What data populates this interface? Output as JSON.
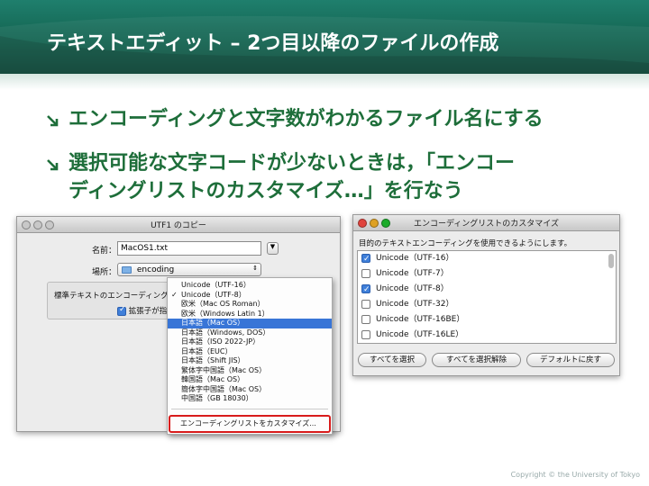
{
  "slide": {
    "title": "テキストエディット – 2つ目以降のファイルの作成",
    "bullets": [
      "エンコーディングと文字数がわかるファイル名にする",
      "選択可能な文字コードが少ないときは，「エンコー",
      "ディングリストのカスタマイズ…」を行なう"
    ],
    "copyright": "Copyright © the University of Tokyo"
  },
  "save_dialog": {
    "title": "UTF1 のコピー",
    "name_label": "名前：",
    "name_value": "MacOS1.txt",
    "location_label": "場所：",
    "location_value": "encoding",
    "encoding_label": "標準テキストのエンコーディング",
    "extension_label": "拡張子が指定",
    "menu_items": [
      {
        "label": "Unicode（UTF-16）",
        "checked": false,
        "selected": false
      },
      {
        "label": "Unicode（UTF-8）",
        "checked": true,
        "selected": false
      },
      {
        "label": "欧米（Mac OS Roman）",
        "checked": false,
        "selected": false
      },
      {
        "label": "欧米（Windows Latin 1）",
        "checked": false,
        "selected": false
      },
      {
        "label": "日本語（Mac OS）",
        "checked": false,
        "selected": true
      },
      {
        "label": "日本語（Windows, DOS）",
        "checked": false,
        "selected": false
      },
      {
        "label": "日本語（ISO 2022-JP）",
        "checked": false,
        "selected": false
      },
      {
        "label": "日本語（EUC）",
        "checked": false,
        "selected": false
      },
      {
        "label": "日本語（Shift JIS）",
        "checked": false,
        "selected": false
      },
      {
        "label": "繁体字中国語（Mac OS）",
        "checked": false,
        "selected": false
      },
      {
        "label": "韓国語（Mac OS）",
        "checked": false,
        "selected": false
      },
      {
        "label": "簡体字中国語（Mac OS）",
        "checked": false,
        "selected": false
      },
      {
        "label": "中国語（GB 18030）",
        "checked": false,
        "selected": false
      }
    ],
    "customize_label": "エンコーディングリストをカスタマイズ..."
  },
  "encoding_list_window": {
    "title": "エンコーディングリストのカスタマイズ",
    "description": "目的のテキストエンコーディングを使用できるようにします。",
    "items": [
      {
        "label": "Unicode（UTF-16）",
        "checked": true
      },
      {
        "label": "Unicode（UTF-7）",
        "checked": false
      },
      {
        "label": "Unicode（UTF-8）",
        "checked": true
      },
      {
        "label": "Unicode（UTF-32）",
        "checked": false
      },
      {
        "label": "Unicode（UTF-16BE）",
        "checked": false
      },
      {
        "label": "Unicode（UTF-16LE）",
        "checked": false
      }
    ],
    "buttons": {
      "select_all": "すべてを選択",
      "deselect_all": "すべてを選択解除",
      "restore_default": "デフォルトに戻す"
    }
  },
  "colors": {
    "banner": "#136350",
    "bullet_text": "#1e6e3a",
    "menu_selection": "#3875d7",
    "highlight_box": "#d81b1b"
  }
}
